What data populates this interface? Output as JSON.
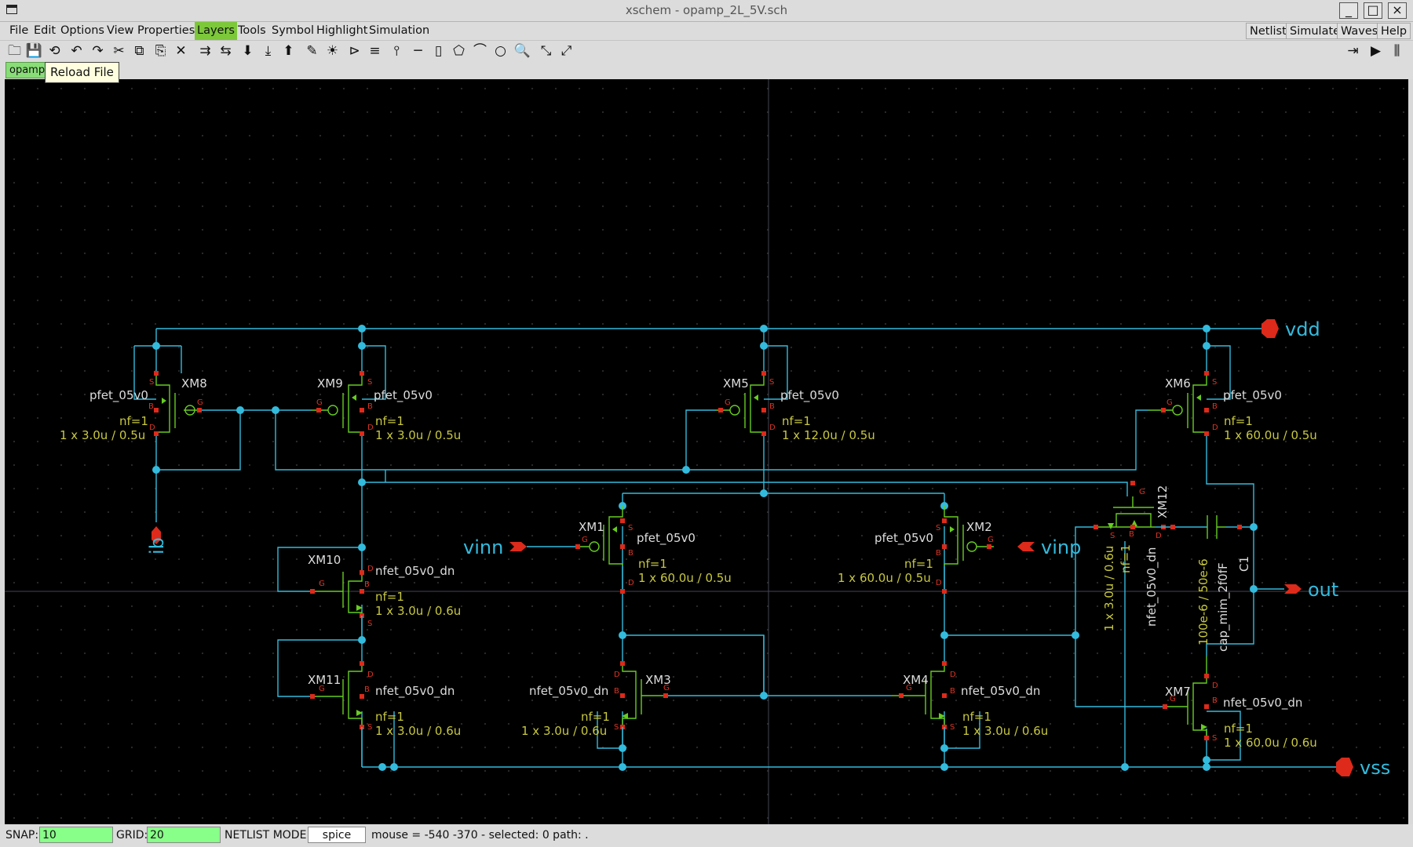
{
  "window": {
    "title": "xschem - opamp_2L_5V.sch"
  },
  "menu": [
    "File",
    "Edit",
    "Options",
    "View",
    "Properties",
    "Layers",
    "Tools",
    "Symbol",
    "Highlight",
    "Simulation"
  ],
  "menu_active": "Layers",
  "right_buttons": [
    "Netlist",
    "Simulate",
    "Waves",
    "Help"
  ],
  "tab": {
    "label": "opamp_"
  },
  "tooltip": "Reload File",
  "status": {
    "snap_label": "SNAP:",
    "snap_value": "10",
    "grid_label": "GRID:",
    "grid_value": "20",
    "netlist_label": "NETLIST MODE:",
    "netlist_value": "spice",
    "info": "mouse = -540 -370 - selected: 0 path: ."
  },
  "colors": {
    "wire": "#33bbdd",
    "symbol": "#66cc22",
    "pin": "#dd2a1a",
    "param": "#c8c840",
    "label": "#dddddd",
    "background": "#000000"
  },
  "schematic": {
    "ports": {
      "vdd": "vdd",
      "vss": "vss",
      "out": "out",
      "vinn": "vinn",
      "vinp": "vinp",
      "ib": "ib"
    },
    "devices": {
      "XM8": {
        "name": "XM8",
        "model": "pfet_05v0",
        "nf": "nf=1",
        "size": "1 x 3.0u / 0.5u"
      },
      "XM9": {
        "name": "XM9",
        "model": "pfet_05v0",
        "nf": "nf=1",
        "size": "1 x 3.0u / 0.5u"
      },
      "XM5": {
        "name": "XM5",
        "model": "pfet_05v0",
        "nf": "nf=1",
        "size": "1 x 12.0u / 0.5u"
      },
      "XM6": {
        "name": "XM6",
        "model": "pfet_05v0",
        "nf": "nf=1",
        "size": "1 x 60.0u / 0.5u"
      },
      "XM1": {
        "name": "XM1",
        "model": "pfet_05v0",
        "nf": "nf=1",
        "size": "1 x 60.0u / 0.5u"
      },
      "XM2": {
        "name": "XM2",
        "model": "pfet_05v0",
        "nf": "nf=1",
        "size": "1 x 60.0u / 0.5u"
      },
      "XM10": {
        "name": "XM10",
        "model": "nfet_05v0_dn",
        "nf": "nf=1",
        "size": "1 x 3.0u / 0.6u"
      },
      "XM11": {
        "name": "XM11",
        "model": "nfet_05v0_dn",
        "nf": "nf=1",
        "size": "1 x 3.0u / 0.6u"
      },
      "XM3": {
        "name": "XM3",
        "model": "nfet_05v0_dn",
        "nf": "nf=1",
        "size": "1 x 3.0u / 0.6u"
      },
      "XM4": {
        "name": "XM4",
        "model": "nfet_05v0_dn",
        "nf": "nf=1",
        "size": "1 x 3.0u / 0.6u"
      },
      "XM7": {
        "name": "XM7",
        "model": "nfet_05v0_dn",
        "nf": "nf=1",
        "size": "1 x 60.0u / 0.6u"
      },
      "XM12": {
        "name": "XM12",
        "model": "nfet_05v0_dn",
        "nf": "nf=1",
        "size": "1 x 3.0u / 0.6u"
      },
      "C1": {
        "name": "C1",
        "model": "cap_mim_2f0fF",
        "value": "100e-6 / 50e-6"
      }
    },
    "pins": {
      "g": "G",
      "s": "S",
      "d": "D",
      "b": "B"
    }
  }
}
